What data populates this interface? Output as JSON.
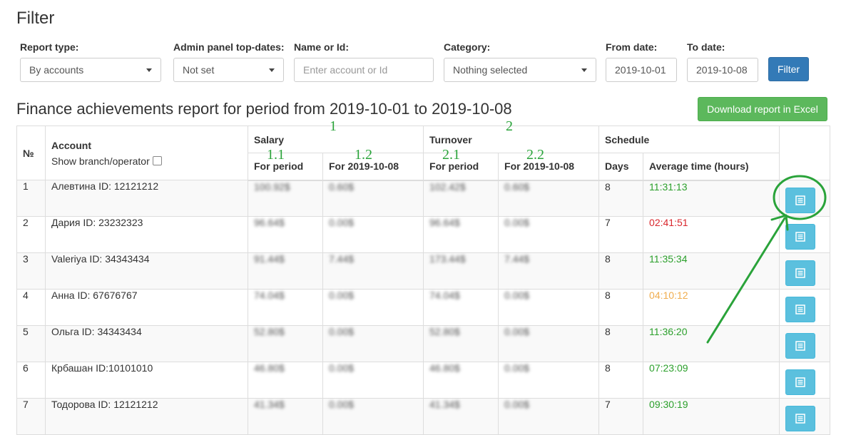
{
  "filter": {
    "title": "Filter",
    "report_type": {
      "label": "Report type:",
      "value": "By accounts"
    },
    "admin_panel": {
      "label": "Admin panel top-dates:",
      "value": "Not set"
    },
    "name_or_id": {
      "label": "Name or Id:",
      "value": "",
      "placeholder": "Enter account or Id"
    },
    "category": {
      "label": "Category:",
      "value": "Nothing selected"
    },
    "from_date": {
      "label": "From date:",
      "value": "2019-10-01"
    },
    "to_date": {
      "label": "To date:",
      "value": "2019-10-08"
    },
    "filter_button": "Filter"
  },
  "report": {
    "title": "Finance achievements report for period from 2019-10-01 to 2019-10-08",
    "download_button": "Download report in Excel",
    "headers": {
      "no": "№",
      "account": "Account",
      "show_branch": "Show branch/operator",
      "salary": "Salary",
      "turnover": "Turnover",
      "schedule": "Schedule",
      "for_period": "For period",
      "for_date": "For 2019-10-08",
      "days": "Days",
      "avg_time": "Average time (hours)"
    },
    "rows": [
      {
        "no": "1",
        "account": "Алевтина  ID: 12121212",
        "salary_period": "100.92$",
        "salary_date": "0.60$",
        "turnover_period": "102.42$",
        "turnover_date": "0.60$",
        "days": "8",
        "avg_time": "11:31:13",
        "time_color": "#2ca02c"
      },
      {
        "no": "2",
        "account": "Дария  ID: 23232323",
        "salary_period": "96.64$",
        "salary_date": "0.00$",
        "turnover_period": "96.64$",
        "turnover_date": "0.00$",
        "days": "7",
        "avg_time": "02:41:51",
        "time_color": "#d9262c"
      },
      {
        "no": "3",
        "account": "Valeriya  ID:  34343434",
        "salary_period": "91.44$",
        "salary_date": "7.44$",
        "turnover_period": "173.44$",
        "turnover_date": "7.44$",
        "days": "8",
        "avg_time": "11:35:34",
        "time_color": "#2ca02c"
      },
      {
        "no": "4",
        "account": "Анна  ID: 67676767",
        "salary_period": "74.04$",
        "salary_date": "0.00$",
        "turnover_period": "74.04$",
        "turnover_date": "0.00$",
        "days": "8",
        "avg_time": "04:10:12",
        "time_color": "#f0ad4e"
      },
      {
        "no": "5",
        "account": "Ольга  ID:  34343434",
        "salary_period": "52.80$",
        "salary_date": "0.00$",
        "turnover_period": "52.80$",
        "turnover_date": "0.00$",
        "days": "8",
        "avg_time": "11:36:20",
        "time_color": "#2ca02c"
      },
      {
        "no": "6",
        "account": "Крбашан  ID:10101010",
        "salary_period": "46.80$",
        "salary_date": "0.00$",
        "turnover_period": "46.80$",
        "turnover_date": "0.00$",
        "days": "8",
        "avg_time": "07:23:09",
        "time_color": "#2ca02c"
      },
      {
        "no": "7",
        "account": "Тодорова  ID: 12121212",
        "salary_period": "41.34$",
        "salary_date": "0.00$",
        "turnover_period": "41.34$",
        "turnover_date": "0.00$",
        "days": "7",
        "avg_time": "09:30:19",
        "time_color": "#2ca02c"
      }
    ]
  },
  "annotations": {
    "salary_num": "1",
    "turnover_num": "2",
    "col_1_1": "1.1",
    "col_1_2": "1.2",
    "col_2_1": "2.1",
    "col_2_2": "2.2",
    "color": "#2aa33a"
  },
  "icons": {
    "view_button": "list-icon",
    "select_caret": "caret-down-icon"
  },
  "colors": {
    "primary": "#337ab7",
    "success": "#5cb85c",
    "info": "#5bc0de"
  }
}
